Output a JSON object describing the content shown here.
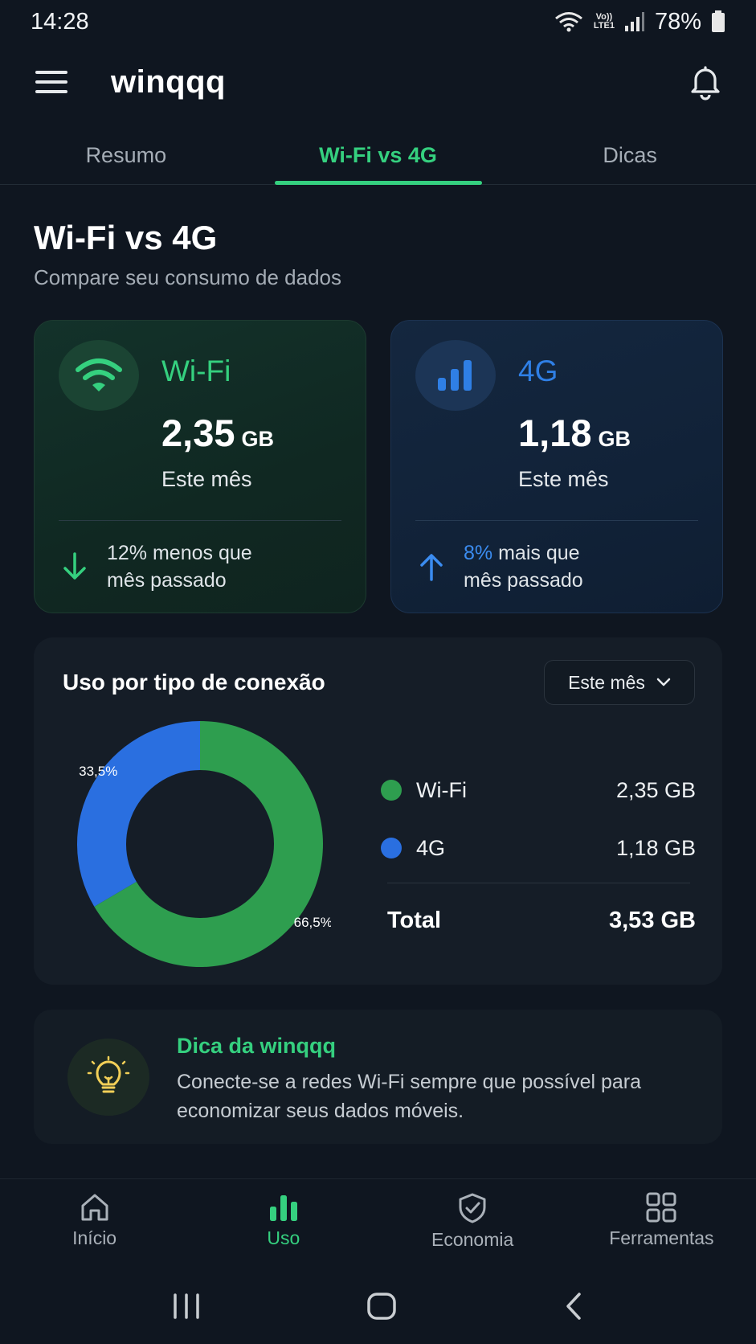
{
  "status_bar": {
    "time": "14:28",
    "volte_line1": "Vo))",
    "volte_line2": "LTE1",
    "battery": "78%"
  },
  "header": {
    "app_name": "winqqq",
    "icons": {
      "menu": "hamburger-icon",
      "notifications": "bell-icon"
    }
  },
  "tabs": [
    {
      "label": "Resumo",
      "active": false
    },
    {
      "label": "Wi-Fi vs 4G",
      "active": true
    },
    {
      "label": "Dicas",
      "active": false
    }
  ],
  "page": {
    "title": "Wi-Fi vs 4G",
    "subtitle": "Compare seu consumo de dados"
  },
  "cards": {
    "wifi": {
      "label": "Wi-Fi",
      "value": "2,35",
      "unit": "GB",
      "period": "Este mês",
      "trend_line1": "12% menos que",
      "trend_line2": "mês passado",
      "trend_direction": "down",
      "icon": "wifi-icon",
      "color": "#35d07f"
    },
    "mobile": {
      "label": "4G",
      "value": "1,18",
      "unit": "GB",
      "period": "Este mês",
      "trend_pct": "8%",
      "trend_line1_rest": "mais que",
      "trend_line2": "mês passado",
      "trend_direction": "up",
      "icon": "signal-bars-icon",
      "color": "#2f7fe5"
    }
  },
  "usage": {
    "title": "Uso por tipo de conexão",
    "period_select": "Este mês",
    "legend": [
      {
        "name": "Wi-Fi",
        "value": "2,35 GB",
        "color": "#2e9e4f"
      },
      {
        "name": "4G",
        "value": "1,18 GB",
        "color": "#2a6fe0"
      }
    ],
    "total_label": "Total",
    "total_value": "3,53 GB"
  },
  "chart_data": {
    "type": "pie",
    "categories": [
      "Wi-Fi",
      "4G"
    ],
    "values": [
      66.5,
      33.5
    ],
    "data_labels": [
      "66,5%",
      "33,5%"
    ],
    "colors": [
      "#2e9e4f",
      "#2a6fe0"
    ],
    "donut": true
  },
  "tip": {
    "title": "Dica da winqqq",
    "text": "Conecte-se a redes Wi-Fi sempre que possível para economizar seus dados móveis.",
    "icon": "lightbulb-icon"
  },
  "bottom_nav": [
    {
      "label": "Início",
      "icon": "home-icon",
      "active": false
    },
    {
      "label": "Uso",
      "icon": "bar-chart-icon",
      "active": true
    },
    {
      "label": "Economia",
      "icon": "shield-check-icon",
      "active": false
    },
    {
      "label": "Ferramentas",
      "icon": "grid-icon",
      "active": false
    }
  ],
  "system_nav": {
    "icons": [
      "recent-apps-icon",
      "home-circle-icon",
      "back-icon"
    ]
  }
}
